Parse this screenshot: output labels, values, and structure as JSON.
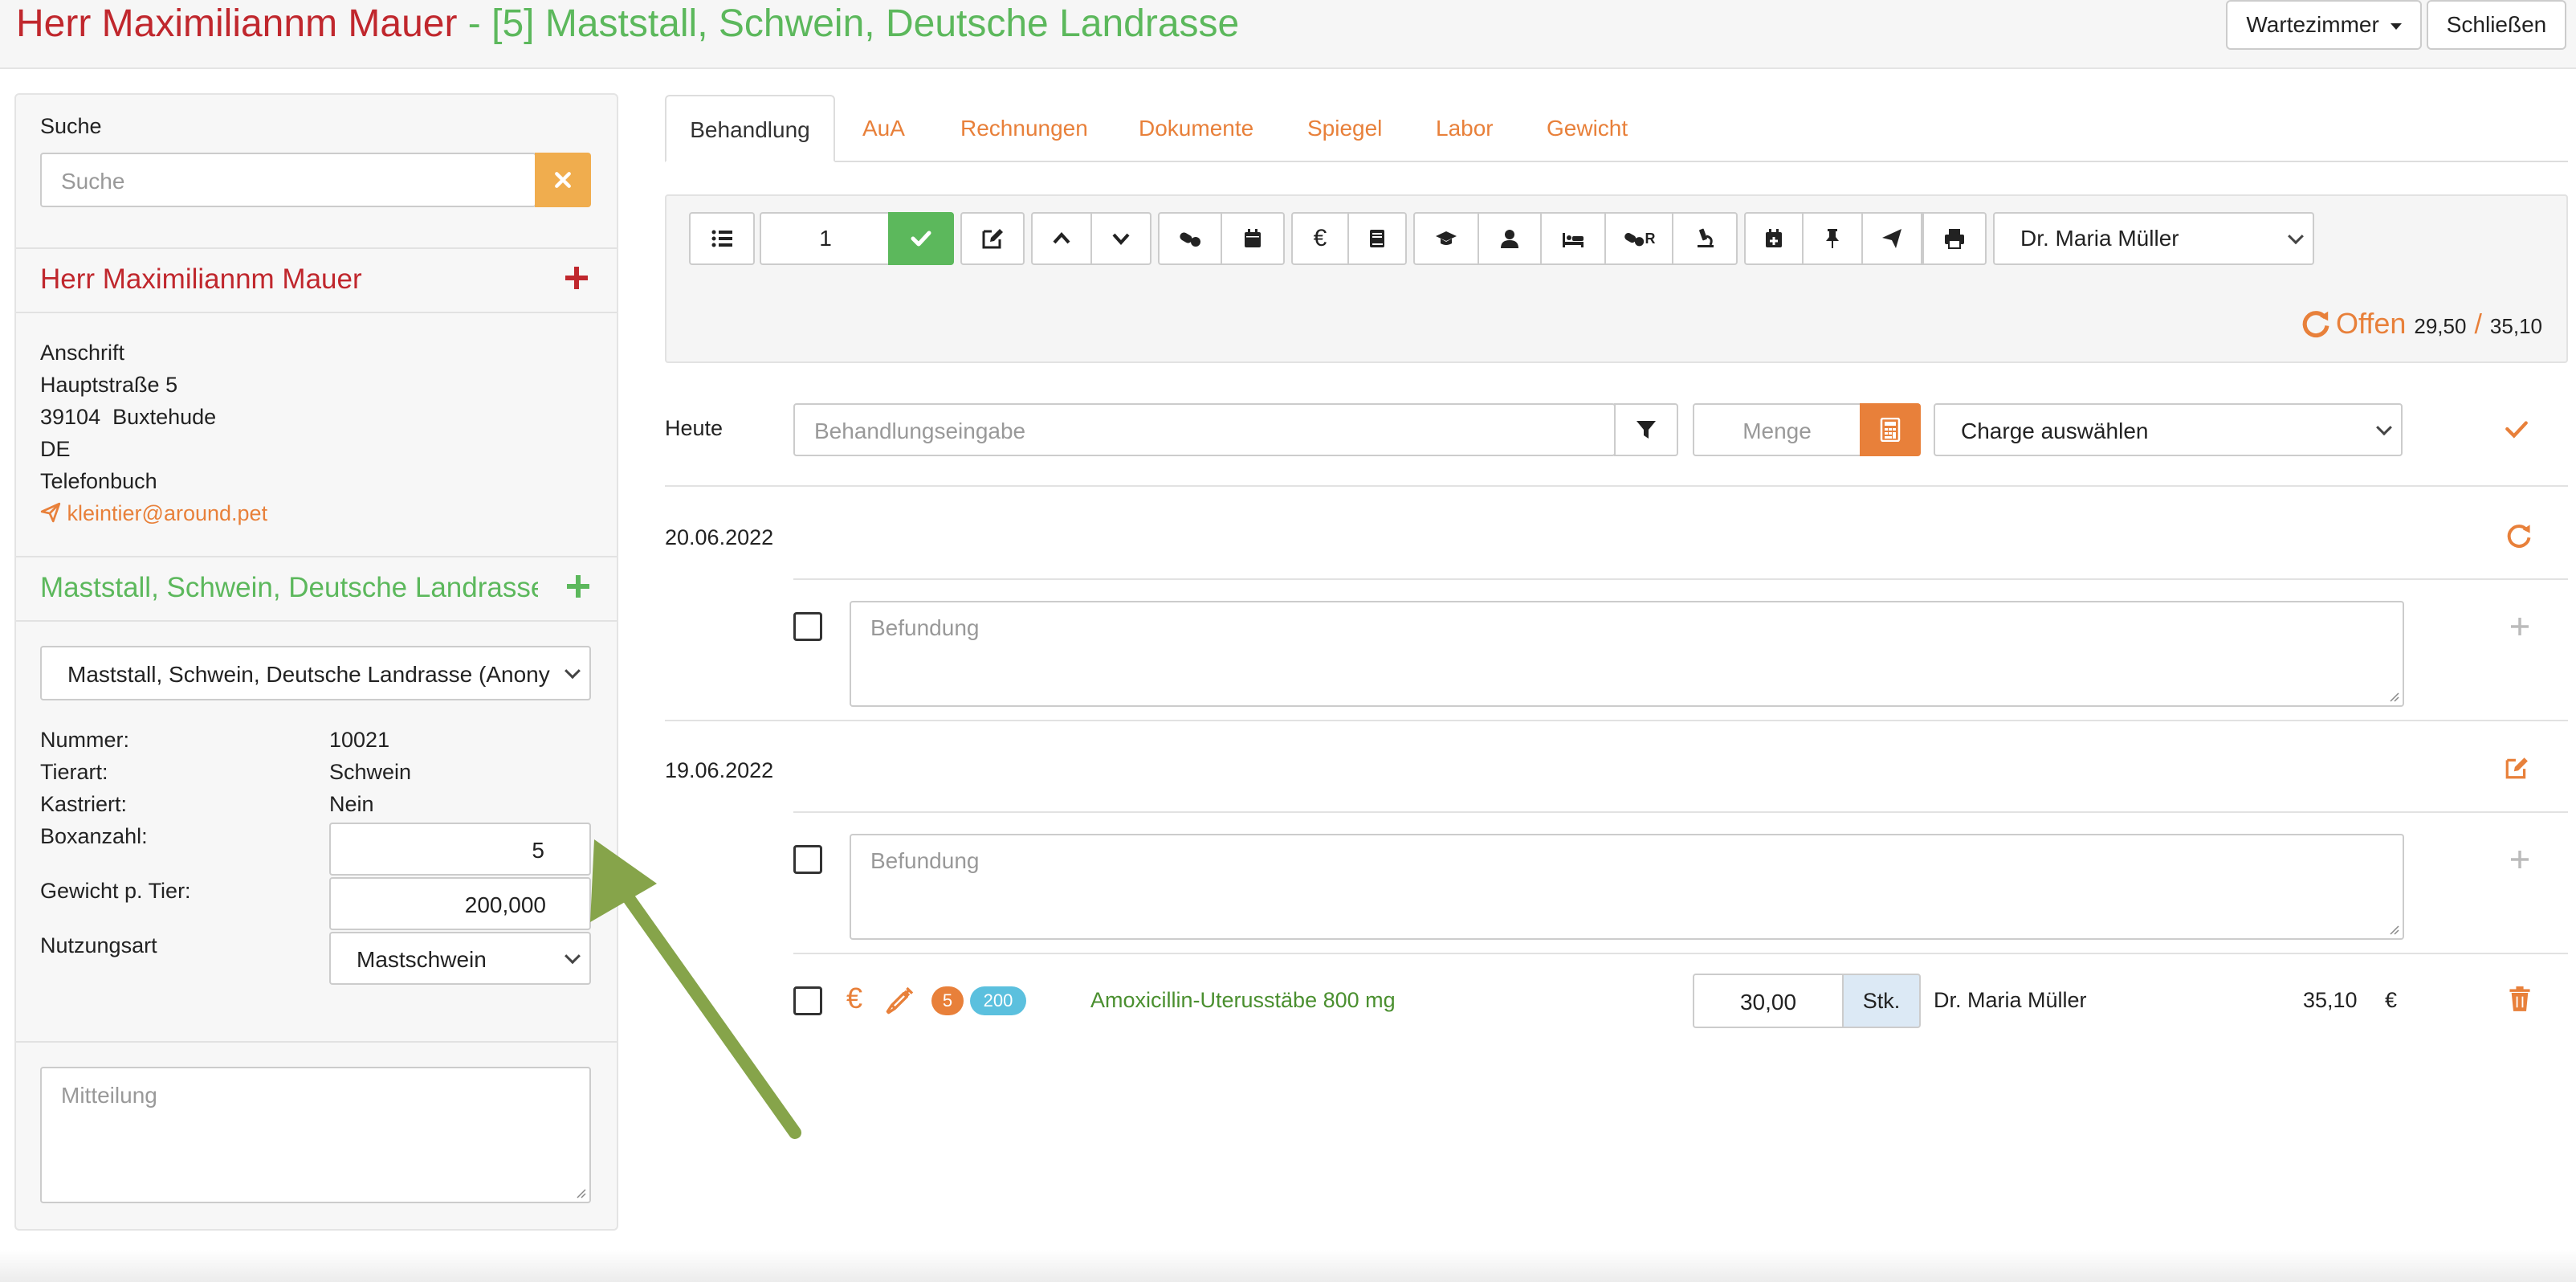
{
  "header": {
    "owner_name": "Herr Maximiliannm Mauer",
    "separator": " - ",
    "animal_title": "[5] Maststall, Schwein, Deutsche Landrasse",
    "waiting_room_label": "Wartezimmer",
    "close_label": "Schließen"
  },
  "search": {
    "label": "Suche",
    "placeholder": "Suche"
  },
  "owner": {
    "name": "Herr Maximiliannm Mauer",
    "address_label": "Anschrift",
    "street": "Hauptstraße 5",
    "city": "39104  Buxtehude",
    "country": "DE",
    "phonebook_label": "Telefonbuch",
    "email": "kleintier@around.pet"
  },
  "animal": {
    "title": "Maststall, Schwein, Deutsche Landrasse",
    "select_value": "Maststall, Schwein, Deutsche Landrasse (Anony",
    "number_label": "Nummer:",
    "number_value": "10021",
    "species_label": "Tierart:",
    "species_value": "Schwein",
    "castrated_label": "Kastriert:",
    "castrated_value": "Nein",
    "box_count_label": "Boxanzahl:",
    "box_count_value": "5",
    "weight_label": "Gewicht p. Tier:",
    "weight_value": "200,000",
    "usage_label": "Nutzungsart",
    "usage_value": "Mastschwein",
    "message_placeholder": "Mitteilung"
  },
  "tabs": [
    {
      "label": "Behandlung",
      "active": true
    },
    {
      "label": "AuA"
    },
    {
      "label": "Rechnungen"
    },
    {
      "label": "Dokumente"
    },
    {
      "label": "Spiegel"
    },
    {
      "label": "Labor"
    },
    {
      "label": "Gewicht"
    }
  ],
  "toolbar": {
    "quantity_value": "1",
    "doctor_select": "Dr. Maria Müller",
    "status_label": "Offen",
    "open_amount": "29,50",
    "amount_separator": "/",
    "total_amount": "35,10",
    "euro_symbol": "€",
    "rx_suffix": "R"
  },
  "entry": {
    "today_label": "Heute",
    "treatment_placeholder": "Behandlungseingabe",
    "quantity_placeholder": "Menge",
    "batch_select": "Charge auswählen"
  },
  "history": [
    {
      "date": "20.06.2022",
      "finding_placeholder": "Befundung"
    },
    {
      "date": "19.06.2022",
      "finding_placeholder": "Befundung",
      "item": {
        "euro_symbol": "€",
        "badge_count": "5",
        "badge_weight": "200",
        "name": "Amoxicillin-Uterusstäbe 800 mg",
        "amount": "30,00",
        "unit": "Stk.",
        "doctor": "Dr. Maria Müller",
        "price": "35,10",
        "currency": "€"
      }
    }
  ],
  "colors": {
    "owner_red": "#c0272d",
    "animal_green": "#5cb85c",
    "accent_orange": "#e8803a",
    "item_green": "#4a8f2f",
    "arrow_green": "#86a44a",
    "badge_blue": "#5bc0de"
  }
}
